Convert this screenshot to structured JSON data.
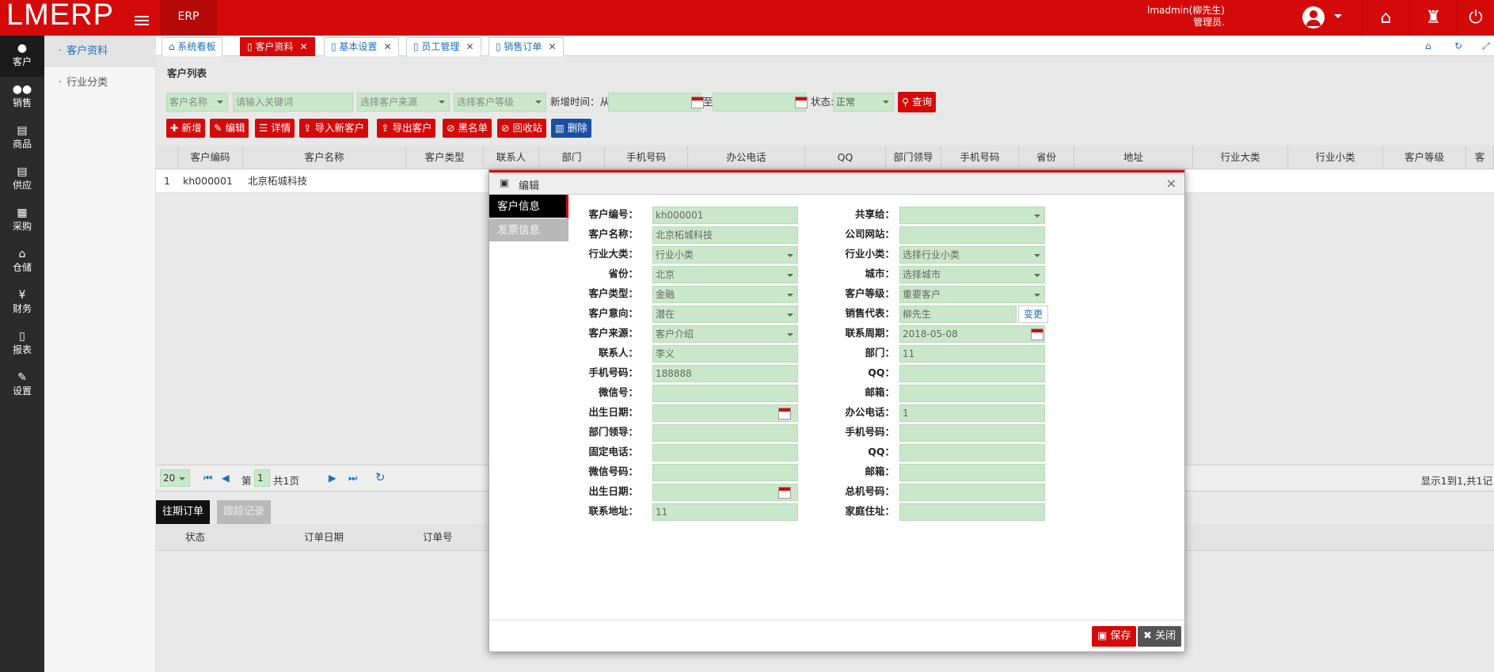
{
  "app": {
    "logo": "LMERP",
    "module": "ERP",
    "user_name": "lmadmin(柳先生)",
    "user_role": "管理员."
  },
  "leftnav": [
    {
      "label": "客户",
      "icon": "user-icon"
    },
    {
      "label": "销售",
      "icon": "users-icon"
    },
    {
      "label": "商品",
      "icon": "card-icon"
    },
    {
      "label": "供应",
      "icon": "card-icon"
    },
    {
      "label": "采购",
      "icon": "basket-icon"
    },
    {
      "label": "仓储",
      "icon": "home-icon"
    },
    {
      "label": "财务",
      "icon": "yen-icon"
    },
    {
      "label": "报表",
      "icon": "doc-icon"
    },
    {
      "label": "设置",
      "icon": "wrench-icon"
    }
  ],
  "subnav": [
    "客户资料",
    "行业分类"
  ],
  "tabs": [
    {
      "label": "系统看板"
    },
    {
      "label": "客户资料"
    },
    {
      "label": "基本设置"
    },
    {
      "label": "员工管理"
    },
    {
      "label": "销售订单"
    }
  ],
  "list": {
    "title": "客户列表"
  },
  "filters": {
    "name_select": "客户名称",
    "keyword_placeholder": "请输入关键词",
    "source_select": "选择客户来源",
    "level_select": "选择客户等级",
    "date_from_label": "新增时间：从",
    "date_to_label": "至",
    "status_label": "状态:",
    "status_value": "正常",
    "search_label": "查询"
  },
  "actions": [
    "新增",
    "编辑",
    "详情",
    "导入新客户",
    "导出客户",
    "黑名单",
    "回收站",
    "删除"
  ],
  "grid": {
    "headers": [
      "客户编码",
      "客户名称",
      "客户类型",
      "联系人",
      "部门",
      "手机号码",
      "办公电话",
      "QQ",
      "部门领导",
      "手机号码",
      "省份",
      "地址",
      "行业大类",
      "行业小类",
      "客户等级",
      "客"
    ],
    "rows": [
      {
        "no": "1",
        "code": "kh000001",
        "name": "北京柘城科技"
      }
    ]
  },
  "pager": {
    "page_size": "20",
    "page_prefix": "第",
    "page_no": "1",
    "page_total": "共1页",
    "summary": "显示1到1,共1记"
  },
  "bottom_tabs": [
    "往期订单",
    "跟踪记录"
  ],
  "order_headers": [
    "状态",
    "订单日期",
    "订单号"
  ],
  "modal": {
    "title": "编辑",
    "tabs": [
      "客户信息",
      "发票信息"
    ],
    "left": [
      {
        "label": "客户编号：",
        "value": "kh000001",
        "kind": "text"
      },
      {
        "label": "客户名称：",
        "value": "北京柘城科技",
        "kind": "text"
      },
      {
        "label": "行业大类：",
        "value": "行业小类",
        "kind": "select"
      },
      {
        "label": "省份：",
        "value": "北京",
        "kind": "select"
      },
      {
        "label": "客户类型：",
        "value": "金融",
        "kind": "select"
      },
      {
        "label": "客户意向：",
        "value": "潜在",
        "kind": "select"
      },
      {
        "label": "客户来源：",
        "value": "客户介绍",
        "kind": "select"
      },
      {
        "label": "联系人：",
        "value": "李义",
        "kind": "text"
      },
      {
        "label": "手机号码：",
        "value": "188888",
        "kind": "text"
      },
      {
        "label": "微信号：",
        "value": "",
        "kind": "text"
      },
      {
        "label": "出生日期：",
        "value": "",
        "kind": "date"
      },
      {
        "label": "部门领导：",
        "value": "",
        "kind": "text"
      },
      {
        "label": "固定电话：",
        "value": "",
        "kind": "text"
      },
      {
        "label": "微信号码：",
        "value": "",
        "kind": "text"
      },
      {
        "label": "出生日期：",
        "value": "",
        "kind": "date"
      },
      {
        "label": "联系地址：",
        "value": "11",
        "kind": "text"
      }
    ],
    "right": [
      {
        "label": "共享给：",
        "value": "",
        "kind": "select"
      },
      {
        "label": "公司网站：",
        "value": "",
        "kind": "text"
      },
      {
        "label": "行业小类：",
        "value": "选择行业小类",
        "kind": "select"
      },
      {
        "label": "城市：",
        "value": "选择城市",
        "kind": "select"
      },
      {
        "label": "客户等级：",
        "value": "重要客户",
        "kind": "select"
      },
      {
        "label": "销售代表：",
        "value": "柳先生",
        "kind": "change",
        "btn": "变更"
      },
      {
        "label": "联系周期：",
        "value": "2018-05-08",
        "kind": "date"
      },
      {
        "label": "部门：",
        "value": "11",
        "kind": "text"
      },
      {
        "label": "QQ：",
        "value": "",
        "kind": "text"
      },
      {
        "label": "邮箱：",
        "value": "",
        "kind": "text"
      },
      {
        "label": "办公电话：",
        "value": "1",
        "kind": "text"
      },
      {
        "label": "手机号码：",
        "value": "",
        "kind": "text"
      },
      {
        "label": "QQ：",
        "value": "",
        "kind": "text"
      },
      {
        "label": "邮箱：",
        "value": "",
        "kind": "text"
      },
      {
        "label": "总机号码：",
        "value": "",
        "kind": "text"
      },
      {
        "label": "家庭住址：",
        "value": "",
        "kind": "text"
      }
    ],
    "save": "保存",
    "close": "关闭"
  },
  "colors": {
    "brand": "#d40a0a",
    "field": "#c9e8c9",
    "blue": "#1a4fa3"
  }
}
